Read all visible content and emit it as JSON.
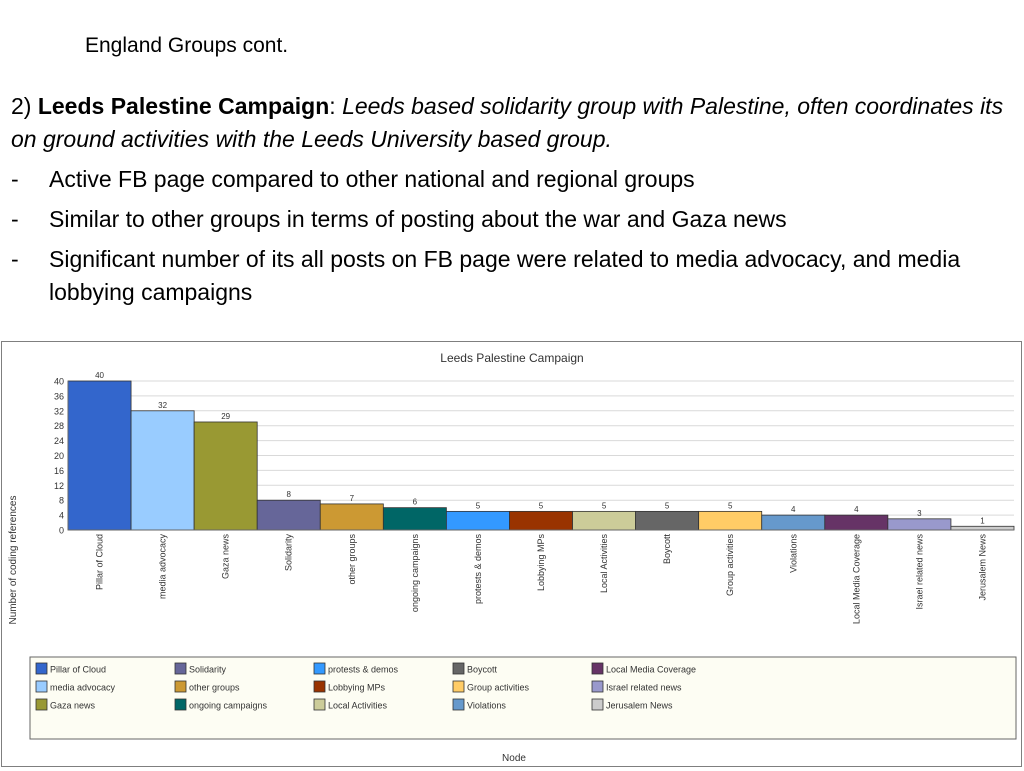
{
  "slide": {
    "title": "England Groups cont.",
    "intro_number": "2) ",
    "intro_name": "Leeds Palestine Campaign",
    "intro_colon": ": ",
    "intro_desc": "Leeds based solidarity group with Palestine, often coordinates its on ground activities with the Leeds University based group.",
    "bullet_marker": "-",
    "bullets": [
      "Active FB page compared to other national and regional groups",
      "Similar to other groups in  terms of posting about the war and Gaza news",
      "Significant number of its all posts on FB page were related to media advocacy, and media lobbying campaigns"
    ]
  },
  "chart_data": {
    "type": "bar",
    "title": "Leeds Palestine Campaign",
    "xlabel": "Node",
    "ylabel": "Number of coding references",
    "ylim": [
      0,
      40
    ],
    "yticks": [
      0,
      4,
      8,
      12,
      16,
      20,
      24,
      28,
      32,
      36,
      40
    ],
    "grid": true,
    "legend_position": "bottom",
    "categories": [
      "Pillar of Cloud",
      "media advocacy",
      "Gaza news",
      "Solidarity",
      "other groups",
      "ongoing campaigns",
      "protests & demos",
      "Lobbying MPs",
      "Local Activities",
      "Boycott",
      "Group activities",
      "Violations",
      "Local Media Coverage",
      "Israel related news",
      "Jerusalem News"
    ],
    "values": [
      40,
      32,
      29,
      8,
      7,
      6,
      5,
      5,
      5,
      5,
      5,
      4,
      4,
      3,
      1
    ],
    "colors": [
      "#3366cc",
      "#99ccff",
      "#999933",
      "#666699",
      "#cc9933",
      "#006666",
      "#3399ff",
      "#993300",
      "#cccc99",
      "#666666",
      "#ffcc66",
      "#6699cc",
      "#663366",
      "#9999cc",
      "#cccccc"
    ],
    "legend_columns": [
      [
        "Pillar of Cloud",
        "media advocacy",
        "Gaza news"
      ],
      [
        "Solidarity",
        "other groups",
        "ongoing campaigns"
      ],
      [
        "protests & demos",
        "Lobbying MPs",
        "Local Activities"
      ],
      [
        "Boycott",
        "Group activities",
        "Violations"
      ],
      [
        "Local Media Coverage",
        "Israel related news",
        "Jerusalem News"
      ]
    ]
  }
}
